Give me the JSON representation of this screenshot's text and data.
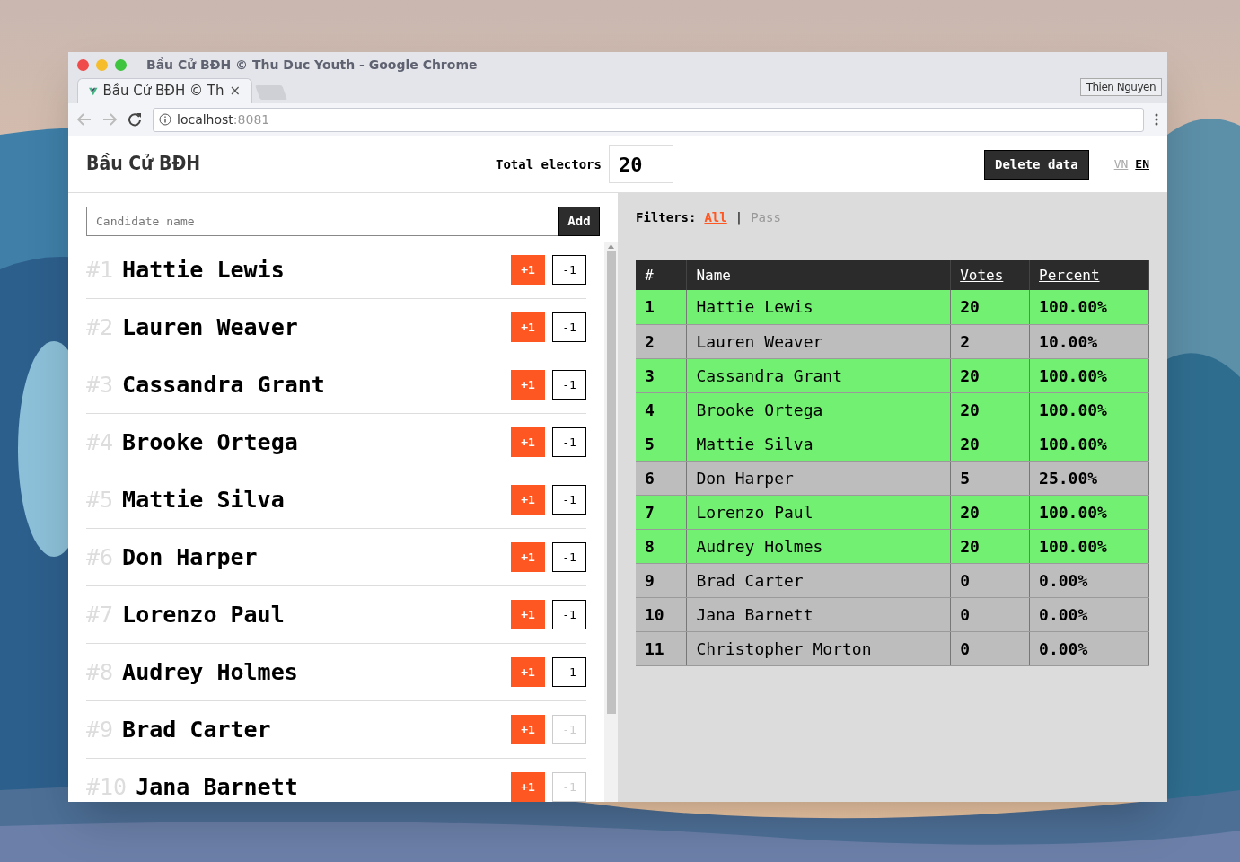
{
  "window": {
    "title": "Bầu Cử BĐH © Thu Duc Youth - Google Chrome",
    "profile": "Thien Nguyen"
  },
  "tabs": [
    {
      "label": "Bầu Cử BĐH © Th",
      "close": "×",
      "selected": true
    }
  ],
  "address_bar": {
    "host": "localhost",
    "port": ":8081"
  },
  "header": {
    "title": "Bầu Cử BĐH",
    "electors_label": "Total electors",
    "electors_value": "20",
    "delete_button": "Delete data",
    "languages": [
      {
        "label": "VN",
        "selected": false
      },
      {
        "label": "EN",
        "selected": true
      }
    ]
  },
  "candidate_form": {
    "placeholder": "Candidate name",
    "add_button": "Add"
  },
  "candidates": [
    {
      "number": "#1",
      "name": "Hattie Lewis",
      "plus": "+1",
      "minus": "-1",
      "minus_disabled": false
    },
    {
      "number": "#2",
      "name": "Lauren Weaver",
      "plus": "+1",
      "minus": "-1",
      "minus_disabled": false
    },
    {
      "number": "#3",
      "name": "Cassandra Grant",
      "plus": "+1",
      "minus": "-1",
      "minus_disabled": false
    },
    {
      "number": "#4",
      "name": "Brooke Ortega",
      "plus": "+1",
      "minus": "-1",
      "minus_disabled": false
    },
    {
      "number": "#5",
      "name": "Mattie Silva",
      "plus": "+1",
      "minus": "-1",
      "minus_disabled": false
    },
    {
      "number": "#6",
      "name": "Don Harper",
      "plus": "+1",
      "minus": "-1",
      "minus_disabled": false
    },
    {
      "number": "#7",
      "name": "Lorenzo Paul",
      "plus": "+1",
      "minus": "-1",
      "minus_disabled": false
    },
    {
      "number": "#8",
      "name": "Audrey Holmes",
      "plus": "+1",
      "minus": "-1",
      "minus_disabled": false
    },
    {
      "number": "#9",
      "name": "Brad Carter",
      "plus": "+1",
      "minus": "-1",
      "minus_disabled": true
    },
    {
      "number": "#10",
      "name": "Jana Barnett",
      "plus": "+1",
      "minus": "-1",
      "minus_disabled": true
    }
  ],
  "filters": {
    "label": "Filters:",
    "separator": "|",
    "options": [
      {
        "label": "All",
        "selected": true
      },
      {
        "label": "Pass",
        "selected": false
      }
    ]
  },
  "results": {
    "columns": [
      {
        "label": "#",
        "sortable": false
      },
      {
        "label": "Name",
        "sortable": false
      },
      {
        "label": "Votes",
        "sortable": true
      },
      {
        "label": "Percent",
        "sortable": true
      }
    ],
    "rows": [
      {
        "rank": "1",
        "name": "Hattie Lewis",
        "votes": "20",
        "percent": "100.00%",
        "pass": true
      },
      {
        "rank": "2",
        "name": "Lauren Weaver",
        "votes": "2",
        "percent": "10.00%",
        "pass": false
      },
      {
        "rank": "3",
        "name": "Cassandra Grant",
        "votes": "20",
        "percent": "100.00%",
        "pass": true
      },
      {
        "rank": "4",
        "name": "Brooke Ortega",
        "votes": "20",
        "percent": "100.00%",
        "pass": true
      },
      {
        "rank": "5",
        "name": "Mattie Silva",
        "votes": "20",
        "percent": "100.00%",
        "pass": true
      },
      {
        "rank": "6",
        "name": "Don Harper",
        "votes": "5",
        "percent": "25.00%",
        "pass": false
      },
      {
        "rank": "7",
        "name": "Lorenzo Paul",
        "votes": "20",
        "percent": "100.00%",
        "pass": true
      },
      {
        "rank": "8",
        "name": "Audrey Holmes",
        "votes": "20",
        "percent": "100.00%",
        "pass": true
      },
      {
        "rank": "9",
        "name": "Brad Carter",
        "votes": "0",
        "percent": "0.00%",
        "pass": false
      },
      {
        "rank": "10",
        "name": "Jana Barnett",
        "votes": "0",
        "percent": "0.00%",
        "pass": false
      },
      {
        "rank": "11",
        "name": "Christopher Morton",
        "votes": "0",
        "percent": "0.00%",
        "pass": false
      }
    ]
  }
}
